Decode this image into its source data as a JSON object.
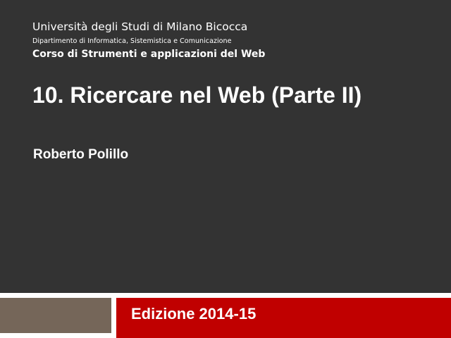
{
  "slide": {
    "university": "Università degli Studi di Milano Bicocca",
    "department": "Dipartimento di Informatica, Sistemistica e Comunicazione",
    "course": "Corso di Strumenti e applicazioni del Web",
    "title": "10. Ricercare nel Web (Parte II)",
    "author": "Roberto Polillo",
    "edition": "Edizione 2014-15"
  },
  "colors": {
    "background_dark": "#333333",
    "accent_brown": "#756659",
    "accent_red": "#c00000",
    "text": "#ffffff"
  }
}
